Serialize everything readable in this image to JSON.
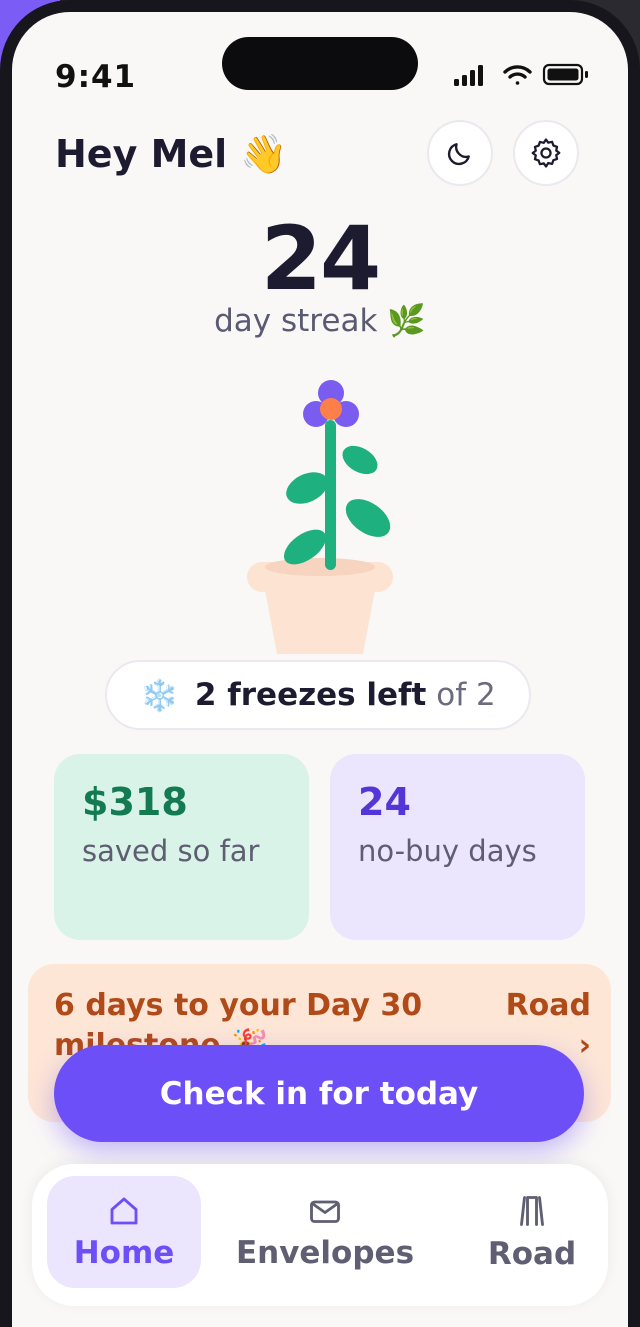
{
  "status_bar": {
    "time": "9:41"
  },
  "header": {
    "greeting": "Hey Mel",
    "wave_emoji": "👋",
    "theme_icon": "moon-icon",
    "settings_icon": "gear-icon"
  },
  "streak": {
    "count": "24",
    "label": "day streak",
    "emoji": "🌿"
  },
  "freezes": {
    "icon": "❄️",
    "value": "2 freezes left",
    "suffix": "of 2"
  },
  "stats": [
    {
      "value": "$318",
      "label": "saved so far",
      "color": "#137a52"
    },
    {
      "value": "24",
      "label": "no-buy days",
      "color": "#5236d8"
    }
  ],
  "milestone": {
    "message": "6 days to your Day 30 milestone 🎉",
    "link": "Road",
    "link_arrow": "›"
  },
  "cta": {
    "label": "Check in for today"
  },
  "tabs": [
    {
      "label": "Home",
      "icon": "home-icon",
      "active": true
    },
    {
      "label": "Envelopes",
      "icon": "envelope-icon",
      "active": false
    },
    {
      "label": "Road",
      "icon": "road-icon",
      "active": false
    }
  ],
  "colors": {
    "accent": "#6d4ff7",
    "background": "#faf8f6",
    "milestone_text": "#b04a19"
  }
}
